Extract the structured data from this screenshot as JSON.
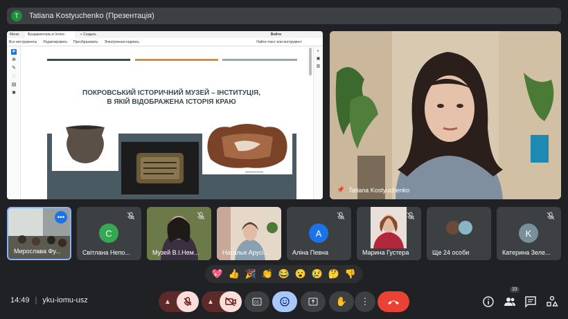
{
  "header": {
    "avatar_letter": "T",
    "title": "Tatiana Kostyuchenko (Презентація)"
  },
  "pdf_viewer": {
    "tabs": [
      "Меню",
      "Фундаменталь в Інтенс",
      "+ Создать"
    ],
    "sign_in": "Войти",
    "toolbar": [
      "Все инструменты",
      "Редактировать",
      "Преобразовать",
      "Электронная подпись"
    ],
    "toolbar_right": "Найти текст или инструмент"
  },
  "slide": {
    "title_line1": "ПОКРОВСЬКИЙ ІСТОРИЧНИЙ МУЗЕЙ – ІНСТИТУЦІЯ,",
    "title_line2": "В ЯКІЙ ВІДОБРАЖЕНА ІСТОРІЯ КРАЮ",
    "colors": {
      "dark": "#3a4a55",
      "orange": "#e08a2a",
      "gray": "#9aa6ae",
      "band": "#4a5a63"
    }
  },
  "speaker": {
    "name": "Tatiana Kostyuchenko",
    "icon": "pin-icon"
  },
  "participants": [
    {
      "name": "Мирослава Фу...",
      "type": "video",
      "active": true
    },
    {
      "name": "Світлана Непо...",
      "type": "letter",
      "letter": "C",
      "color": "#34a853"
    },
    {
      "name": "Музей В.І.Нем...",
      "type": "video"
    },
    {
      "name": "Наталья Арусі...",
      "type": "video"
    },
    {
      "name": "Аліна Певна",
      "type": "letter",
      "letter": "A",
      "color": "#1a73e8"
    },
    {
      "name": "Марина Густера",
      "type": "video"
    },
    {
      "name": "Ще 24 особи",
      "type": "group"
    },
    {
      "name": "Катерина Зеле...",
      "type": "letter",
      "letter": "K",
      "color": "#78909c"
    }
  ],
  "reactions": [
    "💖",
    "👍",
    "🎉",
    "👏",
    "😂",
    "😮",
    "😢",
    "🤔",
    "👎"
  ],
  "footer": {
    "time": "14:49",
    "meeting_code": "yku-iomu-usz",
    "participants_count": "33"
  }
}
